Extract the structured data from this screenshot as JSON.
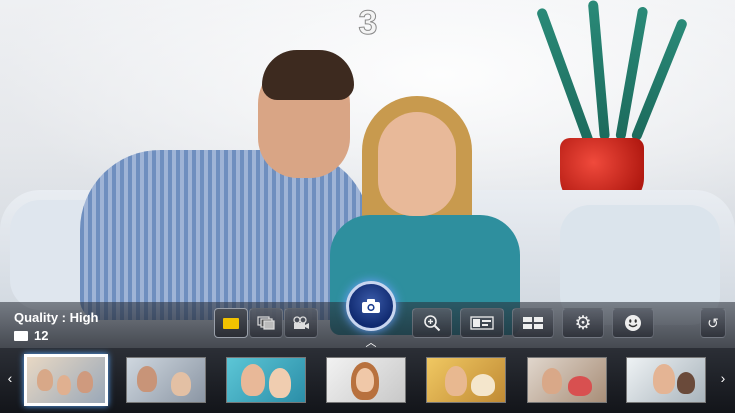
{
  "countdown": "3",
  "status": {
    "quality_label": "Quality : High",
    "shot_count": "12"
  },
  "controls": {
    "modes": [
      {
        "name": "single-shot",
        "icon": "single-frame-icon",
        "active": true
      },
      {
        "name": "burst-shot",
        "icon": "burst-frames-icon",
        "active": false
      },
      {
        "name": "video",
        "icon": "video-camera-icon",
        "active": false
      }
    ],
    "shutter_icon": "camera-icon",
    "tools": [
      {
        "name": "zoom",
        "icon": "zoom-in-icon"
      },
      {
        "name": "layout",
        "icon": "layout-icon"
      },
      {
        "name": "split",
        "icon": "split-screen-icon"
      },
      {
        "name": "settings",
        "icon": "gear-icon"
      },
      {
        "name": "smile",
        "icon": "smile-icon"
      },
      {
        "name": "undo",
        "icon": "undo-icon"
      }
    ]
  },
  "thumbnails": {
    "count": 7,
    "selected_index": 0
  },
  "colors": {
    "accent": "#5aa8ff",
    "active_mode": "#f2c200",
    "shutter": "#1c3d8f"
  }
}
